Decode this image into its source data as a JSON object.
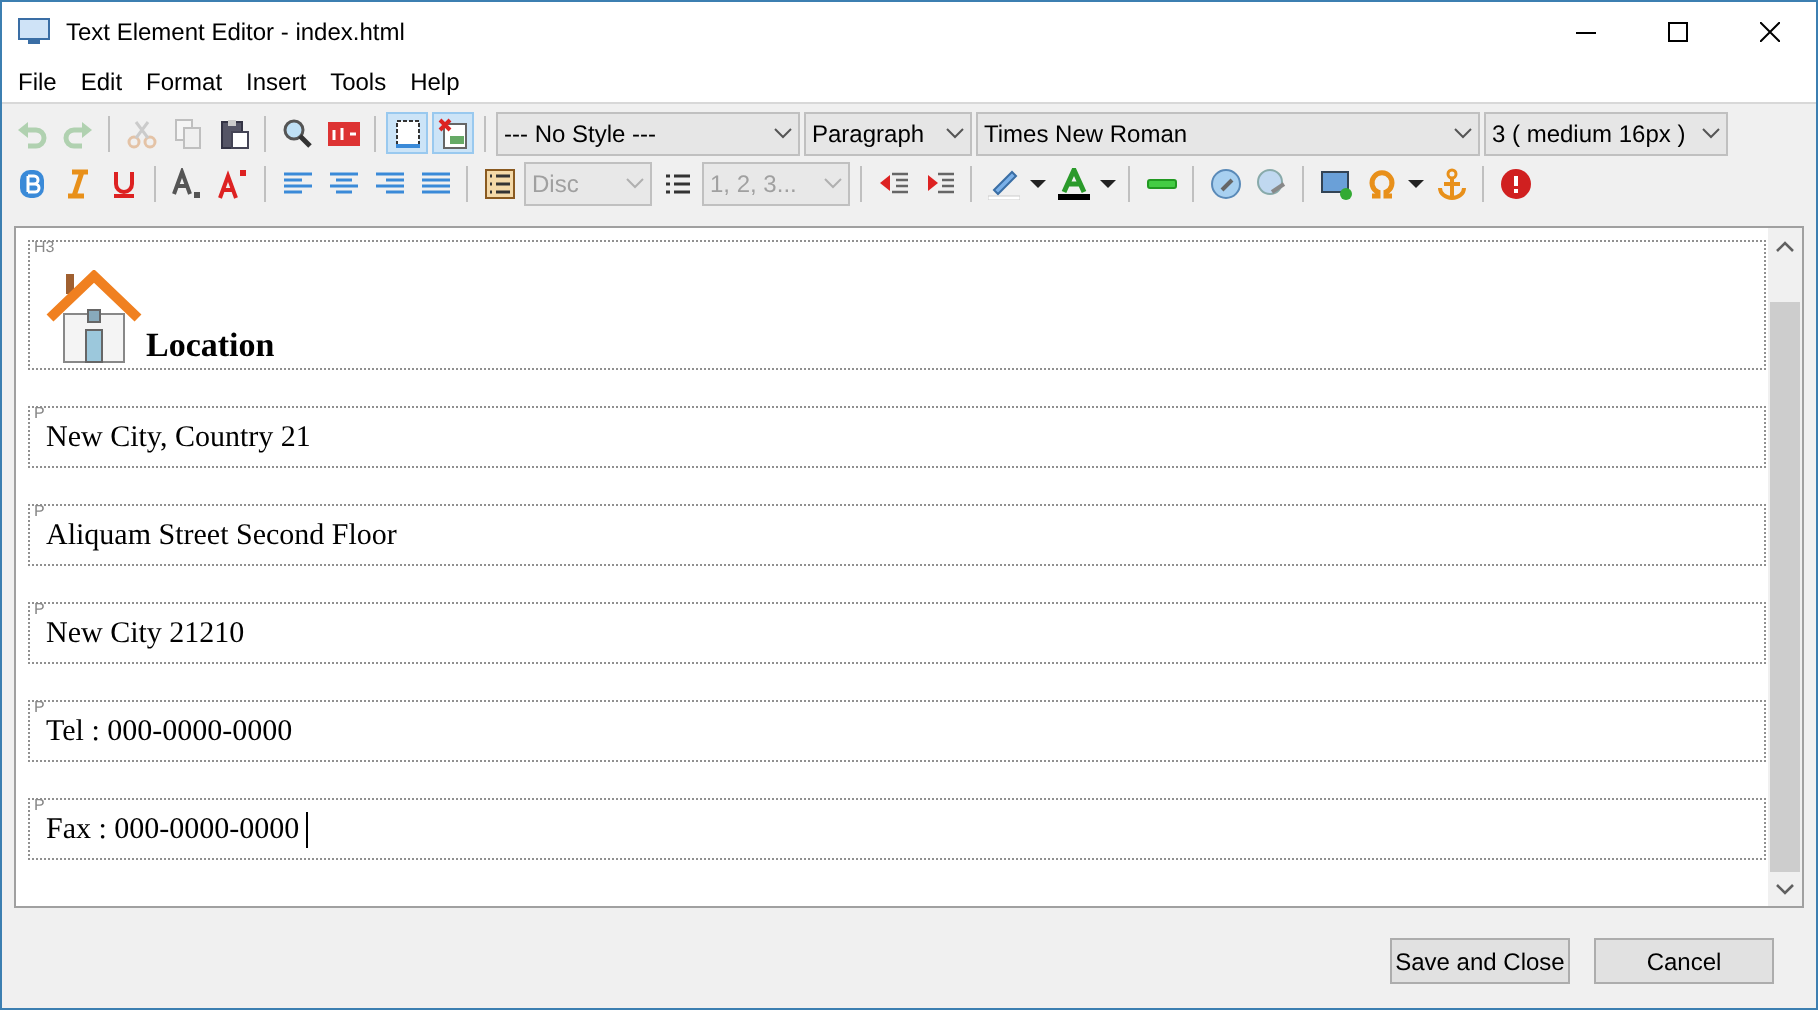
{
  "window": {
    "title": "Text Element Editor - index.html"
  },
  "menu": [
    "File",
    "Edit",
    "Format",
    "Insert",
    "Tools",
    "Help"
  ],
  "toolbar_row_1": [
    {
      "kind": "undo",
      "disabled": true
    },
    {
      "kind": "redo",
      "disabled": true
    },
    {
      "kind": "sep"
    },
    {
      "kind": "cut",
      "disabled": true
    },
    {
      "kind": "copy",
      "disabled": true
    },
    {
      "kind": "paste",
      "disabled": false
    },
    {
      "kind": "sep"
    },
    {
      "kind": "find",
      "disabled": false
    },
    {
      "kind": "spell",
      "disabled": false
    },
    {
      "kind": "sep"
    },
    {
      "kind": "blocks",
      "selected": true
    },
    {
      "kind": "css",
      "selected": true
    },
    {
      "kind": "sep"
    },
    {
      "kind": "dropdown",
      "value": "--- No Style ---",
      "disabled": false
    },
    {
      "kind": "dropdown",
      "value": "Paragraph",
      "disabled": false
    },
    {
      "kind": "dropdown",
      "value": "Times New Roman",
      "disabled": false
    },
    {
      "kind": "dropdown",
      "value": "3 ( medium 16px )",
      "disabled": false
    }
  ],
  "toolbar_row_2": [
    {
      "kind": "bold"
    },
    {
      "kind": "italic"
    },
    {
      "kind": "underline"
    },
    {
      "kind": "sep"
    },
    {
      "kind": "subscript"
    },
    {
      "kind": "superscript"
    },
    {
      "kind": "sep"
    },
    {
      "kind": "align-left"
    },
    {
      "kind": "align-center"
    },
    {
      "kind": "align-right"
    },
    {
      "kind": "justify"
    },
    {
      "kind": "sep"
    },
    {
      "kind": "bullets"
    },
    {
      "kind": "dropdown",
      "value": "Disc",
      "disabled": true
    },
    {
      "kind": "numbers"
    },
    {
      "kind": "dropdown",
      "value": "1, 2, 3...",
      "disabled": true
    },
    {
      "kind": "sep"
    },
    {
      "kind": "outdent"
    },
    {
      "kind": "indent"
    },
    {
      "kind": "sep"
    },
    {
      "kind": "highlight"
    },
    {
      "kind": "caret"
    },
    {
      "kind": "font-color"
    },
    {
      "kind": "caret"
    },
    {
      "kind": "sep"
    },
    {
      "kind": "rule"
    },
    {
      "kind": "sep"
    },
    {
      "kind": "link"
    },
    {
      "kind": "unlink"
    },
    {
      "kind": "sep"
    },
    {
      "kind": "image"
    },
    {
      "kind": "omega"
    },
    {
      "kind": "caret"
    },
    {
      "kind": "anchor"
    },
    {
      "kind": "sep"
    },
    {
      "kind": "help"
    }
  ],
  "blocks": [
    {
      "tag": "H3",
      "text": "Location",
      "kind": "heading",
      "cursor": false
    },
    {
      "tag": "P",
      "text": "New City, Country 21",
      "kind": "paragraph",
      "cursor": false
    },
    {
      "tag": "P",
      "text": "Aliquam Street Second Floor",
      "kind": "paragraph",
      "cursor": false
    },
    {
      "tag": "P",
      "text": "New City 21210",
      "kind": "paragraph",
      "cursor": false
    },
    {
      "tag": "P",
      "text": "Tel : 000-0000-0000",
      "kind": "paragraph",
      "cursor": false
    },
    {
      "tag": "P",
      "text": "Fax : 000-0000-0000",
      "kind": "paragraph",
      "cursor": true
    }
  ],
  "buttons": [
    "Save and Close",
    "Cancel"
  ]
}
